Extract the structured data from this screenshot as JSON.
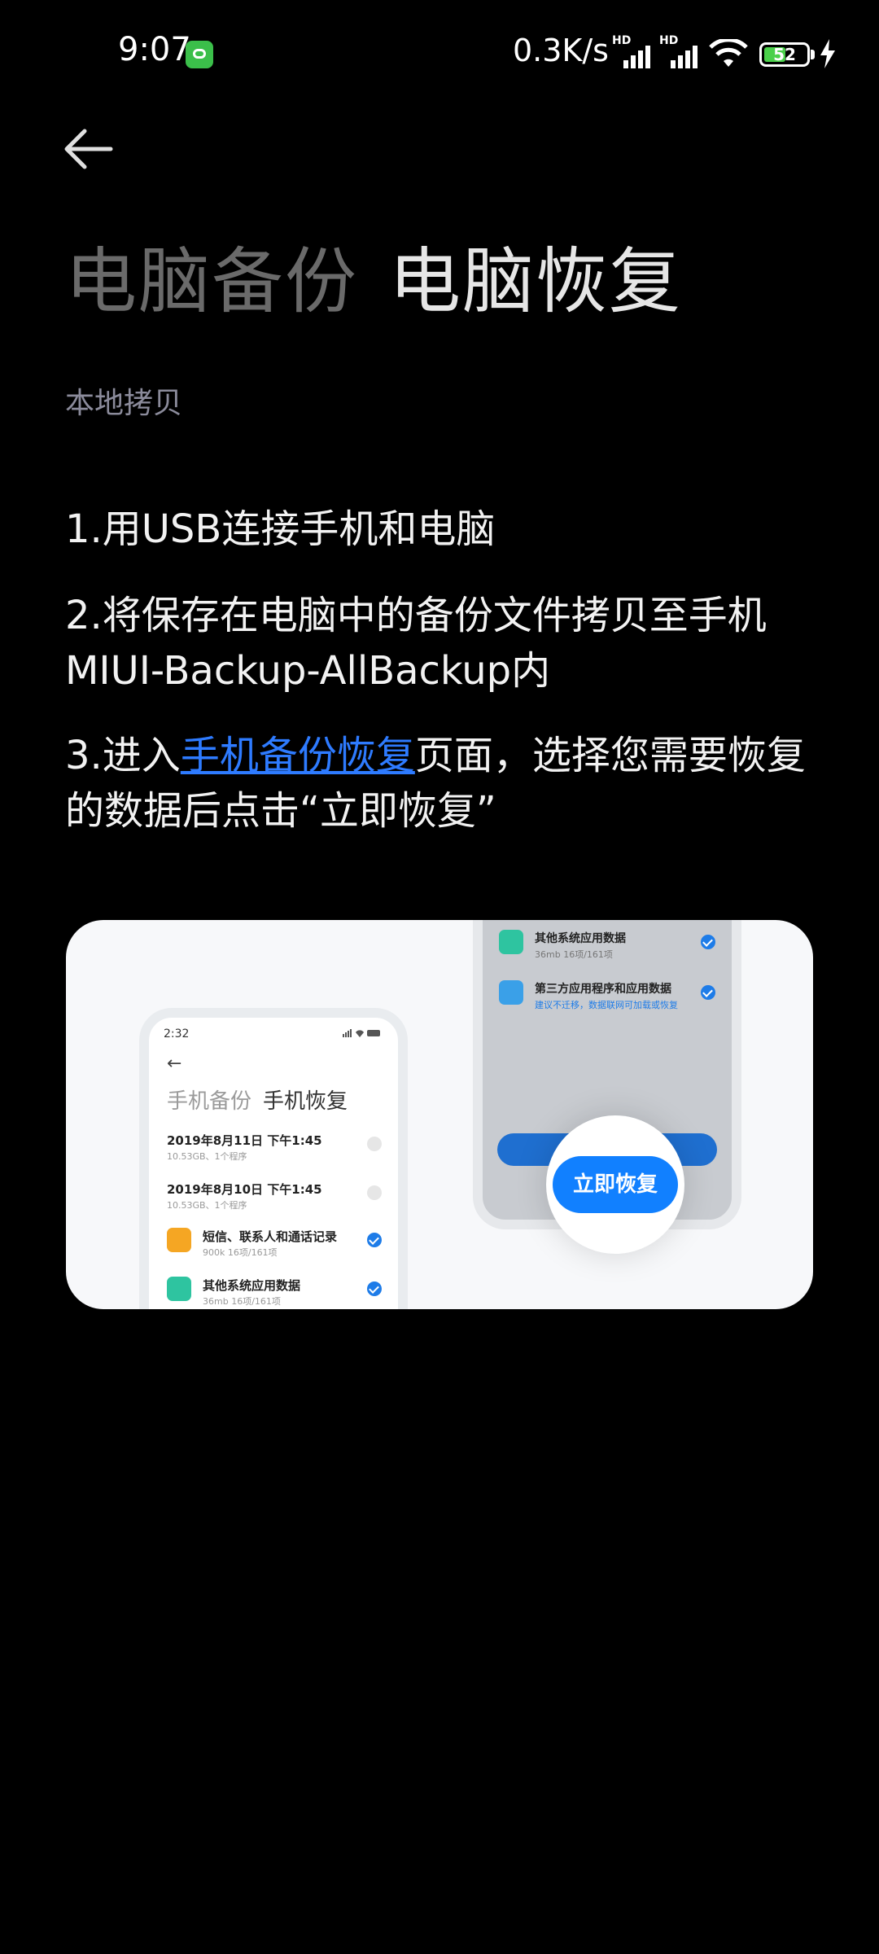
{
  "status_bar": {
    "time": "9:07",
    "net_speed": "0.3K/s",
    "signal_label": "HD",
    "battery": "52",
    "battery_fraction": 0.52,
    "colors": {
      "notif_app": "#3bbf4a",
      "battery_fill": "#4ad04a"
    }
  },
  "header": {
    "back_icon": "arrow-left-icon",
    "tabs": [
      {
        "label": "电脑备份",
        "active": false
      },
      {
        "label": "电脑恢复",
        "active": true
      }
    ],
    "subtitle": "本地拷贝"
  },
  "steps": {
    "step1": "1.用USB连接手机和电脑",
    "step2": "2.将保存在电脑中的备份文件拷贝至手机MIUI-Backup-AllBackup内",
    "step3_prefix": "3.进入",
    "step3_link": "手机备份恢复",
    "step3_suffix": "页面，选择您需要恢复的数据后点击“立即恢复”",
    "link_color": "#2e7bff"
  },
  "illustration": {
    "left_phone": {
      "time": "2:32",
      "tab1": "手机备份",
      "tab2": "手机恢复",
      "rows": [
        {
          "title": "2019年8月11日   下午1:45",
          "sub": "10.53GB、1个程序",
          "checked": false
        },
        {
          "title": "2019年8月10日   下午1:45",
          "sub": "10.53GB、1个程序",
          "checked": false
        },
        {
          "title": "短信、联系人和通话记录",
          "sub": "900k    16项/161项",
          "checked": true,
          "icon_color": "#f5a623"
        },
        {
          "title": "其他系统应用数据",
          "sub": "36mb    16项/161项",
          "checked": true,
          "icon_color": "#2ec4a0"
        }
      ]
    },
    "right_phone": {
      "rows": [
        {
          "title": "其他系统应用数据",
          "sub": "36mb    16项/161项",
          "checked": true,
          "icon_color": "#2ec4a0"
        },
        {
          "title": "第三方应用程序和应用数据",
          "sub": "建议不迁移，数据联网可加载或恢复",
          "checked": true,
          "icon_color": "#3aa0e8"
        }
      ],
      "button": "立即恢复"
    }
  }
}
